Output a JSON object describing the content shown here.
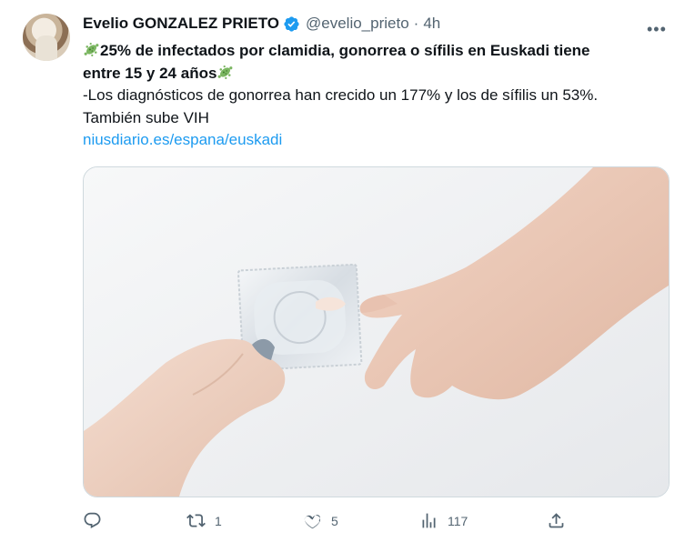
{
  "tweet": {
    "author_name": "Evelio GONZALEZ PRIETO",
    "handle": "@evelio_prieto",
    "separator": "·",
    "time": "4h",
    "headline_line1": "25% de infectados por clamidia, gonorrea o sífilis en Euskadi tiene",
    "headline_line2": "entre 15 y 24 años",
    "body_line1": "-Los diagnósticos de gonorrea han crecido un 177% y los de sífilis un 53%.",
    "body_line2": "También sube VIH",
    "link_text": "niusdiario.es/espana/euskadi"
  },
  "actions": {
    "reply_count": "",
    "retweet_count": "1",
    "like_count": "5",
    "views_count": "117"
  },
  "icons": {
    "verified": "verified-badge-icon",
    "emoji": "microbe-icon",
    "reply": "reply-icon",
    "retweet": "retweet-icon",
    "like": "heart-icon",
    "views": "views-icon",
    "share": "share-icon",
    "more": "more-icon"
  },
  "colors": {
    "accent": "#1d9bf0",
    "muted": "#536471",
    "text": "#0f1419",
    "emoji": "#7bb661"
  }
}
